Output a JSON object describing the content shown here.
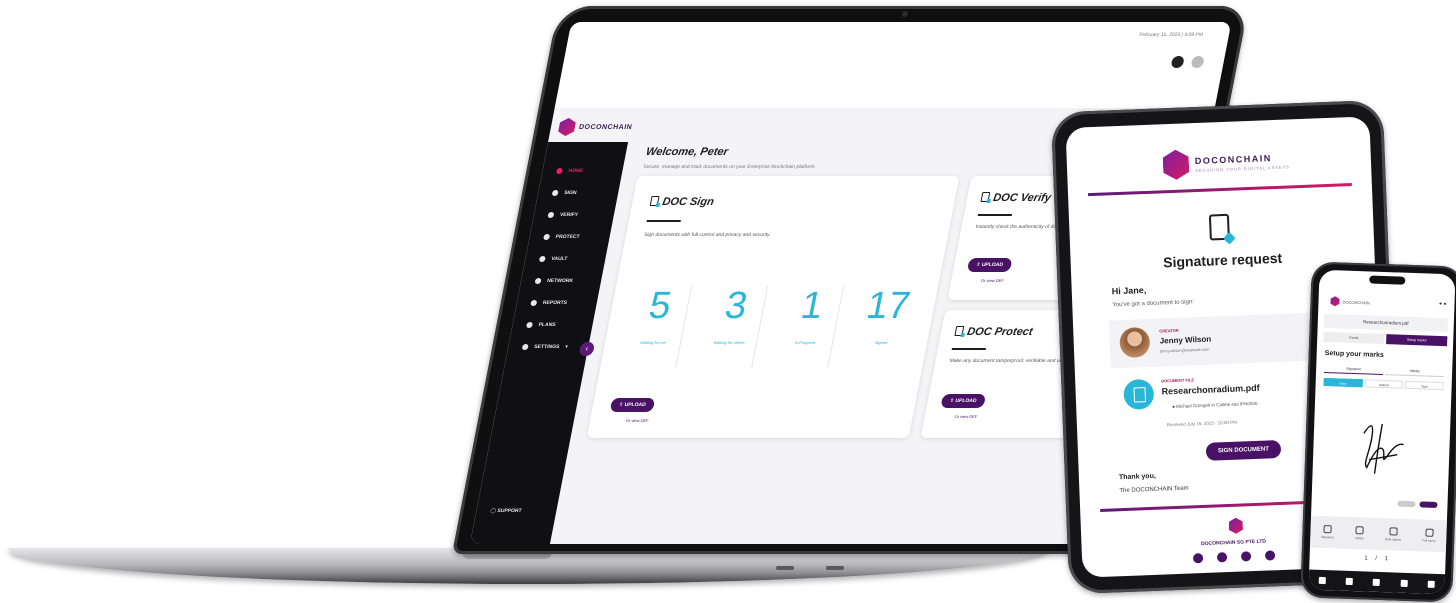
{
  "laptop": {
    "brand": "DOCONCHAIN",
    "date": "February 15, 2023 | 4:09 PM",
    "nav": [
      {
        "label": "Home",
        "active": true
      },
      {
        "label": "Sign",
        "active": false
      },
      {
        "label": "Verify",
        "active": false
      },
      {
        "label": "Protect",
        "active": false
      },
      {
        "label": "Vault",
        "active": false
      },
      {
        "label": "Network",
        "active": false
      },
      {
        "label": "Reports",
        "active": false
      },
      {
        "label": "Plans",
        "active": false
      },
      {
        "label": "Settings",
        "active": false
      }
    ],
    "support": "SUPPORT",
    "welcome": "Welcome, Peter",
    "welcome_sub": "Secure, manage and track documents on your Enterprise blockchain platform.",
    "sign_card": {
      "title": "DOC Sign",
      "desc": "Sign documents with full control and privacy and security.",
      "stats": [
        {
          "value": "5",
          "label": "Waiting for me"
        },
        {
          "value": "3",
          "label": "Waiting for others"
        },
        {
          "value": "1",
          "label": "In Progress"
        },
        {
          "value": "17",
          "label": "Signed"
        }
      ],
      "button": "Upload",
      "link": "Or view DEF"
    },
    "verify_card": {
      "title": "DOC Verify",
      "desc": "Instantly check the authenticity of documents.",
      "button": "Upload",
      "link": "Or view DEF"
    },
    "protect_card": {
      "title": "DOC Protect",
      "desc": "Make any document tamperproof, verifiable and unique.",
      "button": "Upload",
      "link": "Or view DEF"
    }
  },
  "tablet": {
    "brand": "DOCONCHAIN",
    "brand_sub": "SECURING YOUR DIGITAL ASSETS",
    "title": "Signature request",
    "greeting": "Hi Jane,",
    "intro": "You've got a document to sign:",
    "creator_label": "Creator",
    "creator_name": "Jenny Wilson",
    "creator_email": "jenny.wilson@example.com",
    "file_label": "Document file",
    "file_name": "Researchonradium.pdf",
    "file_info": "Michael Grüngelt in Callete eas IPN0006",
    "file_date": "Received July 18, 2023 · 10:00 PM",
    "sign_button": "SIGN DOCUMENT",
    "thanks": "Thank you,",
    "team": "The DOCONCHAIN Team",
    "company": "DOCONCHAIN SG PTE LTD"
  },
  "phone": {
    "brand": "DOCONCHAIN",
    "file_tab": "Researchonradium.pdf",
    "tabs": [
      "Fields",
      "Setup marks"
    ],
    "title": "Setup your marks",
    "modes": [
      "Signature",
      "Initials"
    ],
    "methods": [
      "Draw",
      "Upload",
      "Type"
    ],
    "tools": [
      "Signature",
      "Initials",
      "Date signed",
      "Full name"
    ],
    "pager": "1 / 1"
  },
  "colors": {
    "accent": "#4a1266",
    "brand_pink": "#d81b60",
    "stat_cyan": "#29b6d8"
  }
}
